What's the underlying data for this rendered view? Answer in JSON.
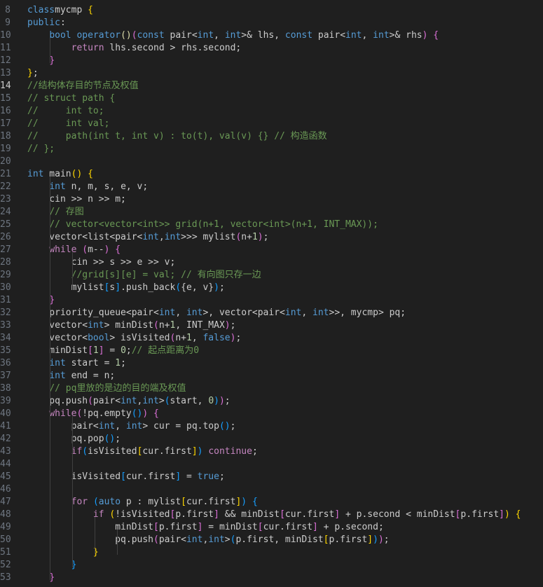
{
  "editor": {
    "background": "#1f1f1f",
    "lines": [
      {
        "n": "8",
        "tokens": [
          [
            "kw",
            "class"
          ],
          [
            "",
            "mycmp "
          ],
          [
            "b1",
            "{"
          ]
        ]
      },
      {
        "n": "9",
        "tokens": [
          [
            "kw",
            "public"
          ],
          [
            "",
            ":"
          ]
        ]
      },
      {
        "n": "10",
        "tokens": [
          [
            "",
            "    "
          ],
          [
            "kw",
            "bool"
          ],
          [
            "",
            " "
          ],
          [
            "kw",
            "operator"
          ],
          [
            "fn",
            "()"
          ],
          [
            "b2",
            "("
          ],
          [
            "kw",
            "const"
          ],
          [
            "",
            " pair<"
          ],
          [
            "kw",
            "int"
          ],
          [
            "",
            ", "
          ],
          [
            "kw",
            "int"
          ],
          [
            "",
            ">& lhs, "
          ],
          [
            "kw",
            "const"
          ],
          [
            "",
            " pair<"
          ],
          [
            "kw",
            "int"
          ],
          [
            "",
            ", "
          ],
          [
            "kw",
            "int"
          ],
          [
            "",
            ">& rhs"
          ],
          [
            "b2",
            ")"
          ],
          [
            "",
            " "
          ],
          [
            "b2",
            "{"
          ]
        ]
      },
      {
        "n": "11",
        "tokens": [
          [
            "",
            "        "
          ],
          [
            "ctl",
            "return"
          ],
          [
            "",
            " lhs.second > rhs.second;"
          ]
        ]
      },
      {
        "n": "12",
        "tokens": [
          [
            "",
            "    "
          ],
          [
            "b2",
            "}"
          ]
        ]
      },
      {
        "n": "13",
        "tokens": [
          [
            "b1",
            "}"
          ],
          [
            "",
            ";"
          ]
        ]
      },
      {
        "n": "14",
        "current": true,
        "tokens": [
          [
            "cm",
            "//结构体存目的节点及权值"
          ]
        ]
      },
      {
        "n": "15",
        "tokens": [
          [
            "cm",
            "// struct path {"
          ]
        ]
      },
      {
        "n": "16",
        "tokens": [
          [
            "cm",
            "//     int to;"
          ]
        ]
      },
      {
        "n": "17",
        "tokens": [
          [
            "cm",
            "//     int val;"
          ]
        ]
      },
      {
        "n": "18",
        "tokens": [
          [
            "cm",
            "//     path(int t, int v) : to(t), val(v) {} // 构造函数"
          ]
        ]
      },
      {
        "n": "19",
        "tokens": [
          [
            "cm",
            "// };"
          ]
        ]
      },
      {
        "n": "20",
        "tokens": []
      },
      {
        "n": "21",
        "tokens": [
          [
            "kw",
            "int"
          ],
          [
            "",
            " main"
          ],
          [
            "b1",
            "()"
          ],
          [
            "",
            " "
          ],
          [
            "b1",
            "{"
          ]
        ]
      },
      {
        "n": "22",
        "tokens": [
          [
            "",
            "    "
          ],
          [
            "kw",
            "int"
          ],
          [
            "",
            " n, m, s, e, v;"
          ]
        ]
      },
      {
        "n": "23",
        "tokens": [
          [
            "",
            "    cin >> n >> m;"
          ]
        ]
      },
      {
        "n": "24",
        "tokens": [
          [
            "",
            "    "
          ],
          [
            "cm",
            "// 存图"
          ]
        ]
      },
      {
        "n": "25",
        "tokens": [
          [
            "",
            "    "
          ],
          [
            "cm",
            "// vector<vector<int>> grid(n+1, vector<int>(n+1, INT_MAX));"
          ]
        ]
      },
      {
        "n": "26",
        "tokens": [
          [
            "",
            "    vector<list<pair<"
          ],
          [
            "kw",
            "int"
          ],
          [
            "",
            ","
          ],
          [
            "kw",
            "int"
          ],
          [
            "",
            ">>> mylist"
          ],
          [
            "b2",
            "("
          ],
          [
            "",
            "n+"
          ],
          [
            "num",
            "1"
          ],
          [
            "b2",
            ")"
          ],
          [
            "",
            ";"
          ]
        ]
      },
      {
        "n": "27",
        "tokens": [
          [
            "",
            "    "
          ],
          [
            "ctl",
            "while"
          ],
          [
            "",
            " "
          ],
          [
            "b2",
            "("
          ],
          [
            "",
            "m--"
          ],
          [
            "b2",
            ")"
          ],
          [
            "",
            " "
          ],
          [
            "b2",
            "{"
          ]
        ]
      },
      {
        "n": "28",
        "tokens": [
          [
            "",
            "        cin >> s >> e >> v;"
          ]
        ]
      },
      {
        "n": "29",
        "tokens": [
          [
            "",
            "        "
          ],
          [
            "cm",
            "//grid[s][e] = val; // 有向图只存一边"
          ]
        ]
      },
      {
        "n": "30",
        "tokens": [
          [
            "",
            "        mylist"
          ],
          [
            "b3",
            "["
          ],
          [
            "",
            "s"
          ],
          [
            "b3",
            "]"
          ],
          [
            "",
            ".push_back"
          ],
          [
            "b3",
            "("
          ],
          [
            "",
            "{e, v}"
          ],
          [
            "b3",
            ")"
          ],
          [
            "",
            ";"
          ]
        ]
      },
      {
        "n": "31",
        "tokens": [
          [
            "",
            "    "
          ],
          [
            "b2",
            "}"
          ]
        ]
      },
      {
        "n": "32",
        "tokens": [
          [
            "",
            "    priority_queue<pair<"
          ],
          [
            "kw",
            "int"
          ],
          [
            "",
            ", "
          ],
          [
            "kw",
            "int"
          ],
          [
            "",
            ">, vector<pair<"
          ],
          [
            "kw",
            "int"
          ],
          [
            "",
            ", "
          ],
          [
            "kw",
            "int"
          ],
          [
            "",
            ">>, mycmp> pq;"
          ]
        ]
      },
      {
        "n": "33",
        "tokens": [
          [
            "",
            "    vector<"
          ],
          [
            "kw",
            "int"
          ],
          [
            "",
            "> minDist"
          ],
          [
            "b2",
            "("
          ],
          [
            "",
            "n+"
          ],
          [
            "num",
            "1"
          ],
          [
            "",
            ", INT_MAX"
          ],
          [
            "b2",
            ")"
          ],
          [
            "",
            ";"
          ]
        ]
      },
      {
        "n": "34",
        "tokens": [
          [
            "",
            "    vector<"
          ],
          [
            "kw",
            "bool"
          ],
          [
            "",
            "> isVisited"
          ],
          [
            "b2",
            "("
          ],
          [
            "",
            "n+"
          ],
          [
            "num",
            "1"
          ],
          [
            "",
            ", "
          ],
          [
            "kw",
            "false"
          ],
          [
            "b2",
            ")"
          ],
          [
            "",
            ";"
          ]
        ]
      },
      {
        "n": "35",
        "tokens": [
          [
            "",
            "    minDist"
          ],
          [
            "b2",
            "["
          ],
          [
            "num",
            "1"
          ],
          [
            "b2",
            "]"
          ],
          [
            "",
            " = "
          ],
          [
            "num",
            "0"
          ],
          [
            "",
            ";"
          ],
          [
            "cm",
            "// 起点距离为0"
          ]
        ]
      },
      {
        "n": "36",
        "tokens": [
          [
            "",
            "    "
          ],
          [
            "kw",
            "int"
          ],
          [
            "",
            " start = "
          ],
          [
            "num",
            "1"
          ],
          [
            "",
            ";"
          ]
        ]
      },
      {
        "n": "37",
        "tokens": [
          [
            "",
            "    "
          ],
          [
            "kw",
            "int"
          ],
          [
            "",
            " end = n;"
          ]
        ]
      },
      {
        "n": "38",
        "tokens": [
          [
            "",
            "    "
          ],
          [
            "cm",
            "// pq里放的是边的目的端及权值"
          ]
        ]
      },
      {
        "n": "39",
        "tokens": [
          [
            "",
            "    pq.push"
          ],
          [
            "b2",
            "("
          ],
          [
            "",
            "pair<"
          ],
          [
            "kw",
            "int"
          ],
          [
            "",
            ","
          ],
          [
            "kw",
            "int"
          ],
          [
            "",
            ">"
          ],
          [
            "b3",
            "("
          ],
          [
            "",
            "start, "
          ],
          [
            "num",
            "0"
          ],
          [
            "b3",
            ")"
          ],
          [
            "b2",
            ")"
          ],
          [
            "",
            ";"
          ]
        ]
      },
      {
        "n": "40",
        "tokens": [
          [
            "",
            "    "
          ],
          [
            "ctl",
            "while"
          ],
          [
            "b2",
            "("
          ],
          [
            "",
            "!pq.empty"
          ],
          [
            "b3",
            "()"
          ],
          [
            "b2",
            ")"
          ],
          [
            "",
            " "
          ],
          [
            "b2",
            "{"
          ]
        ]
      },
      {
        "n": "41",
        "tokens": [
          [
            "",
            "        pair<"
          ],
          [
            "kw",
            "int"
          ],
          [
            "",
            ", "
          ],
          [
            "kw",
            "int"
          ],
          [
            "",
            "> cur = pq.top"
          ],
          [
            "b3",
            "()"
          ],
          [
            "",
            ";"
          ]
        ]
      },
      {
        "n": "42",
        "tokens": [
          [
            "",
            "        pq.pop"
          ],
          [
            "b3",
            "()"
          ],
          [
            "",
            ";"
          ]
        ]
      },
      {
        "n": "43",
        "tokens": [
          [
            "",
            "        "
          ],
          [
            "ctl",
            "if"
          ],
          [
            "b3",
            "("
          ],
          [
            "",
            "isVisited"
          ],
          [
            "b1",
            "["
          ],
          [
            "",
            "cur.first"
          ],
          [
            "b1",
            "]"
          ],
          [
            "b3",
            ")"
          ],
          [
            "",
            " "
          ],
          [
            "ctl",
            "continue"
          ],
          [
            "",
            ";"
          ]
        ]
      },
      {
        "n": "44",
        "tokens": []
      },
      {
        "n": "45",
        "tokens": [
          [
            "",
            "        isVisited"
          ],
          [
            "b3",
            "["
          ],
          [
            "",
            "cur.first"
          ],
          [
            "b3",
            "]"
          ],
          [
            "",
            " = "
          ],
          [
            "kw",
            "true"
          ],
          [
            "",
            ";"
          ]
        ]
      },
      {
        "n": "46",
        "tokens": []
      },
      {
        "n": "47",
        "tokens": [
          [
            "",
            "        "
          ],
          [
            "ctl",
            "for"
          ],
          [
            "",
            " "
          ],
          [
            "b3",
            "("
          ],
          [
            "kw",
            "auto"
          ],
          [
            "",
            " p : mylist"
          ],
          [
            "b1",
            "["
          ],
          [
            "",
            "cur.first"
          ],
          [
            "b1",
            "]"
          ],
          [
            "b3",
            ")"
          ],
          [
            "",
            " "
          ],
          [
            "b3",
            "{"
          ]
        ]
      },
      {
        "n": "48",
        "tokens": [
          [
            "",
            "            "
          ],
          [
            "ctl",
            "if"
          ],
          [
            "",
            " "
          ],
          [
            "b1",
            "("
          ],
          [
            "",
            "!isVisited"
          ],
          [
            "b2",
            "["
          ],
          [
            "",
            "p.first"
          ],
          [
            "b2",
            "]"
          ],
          [
            "",
            " && minDist"
          ],
          [
            "b2",
            "["
          ],
          [
            "",
            "cur.first"
          ],
          [
            "b2",
            "]"
          ],
          [
            "",
            " + p.second < minDist"
          ],
          [
            "b2",
            "["
          ],
          [
            "",
            "p.first"
          ],
          [
            "b2",
            "]"
          ],
          [
            "b1",
            ")"
          ],
          [
            "",
            " "
          ],
          [
            "b1",
            "{"
          ]
        ]
      },
      {
        "n": "49",
        "tokens": [
          [
            "",
            "                minDist"
          ],
          [
            "b2",
            "["
          ],
          [
            "",
            "p.first"
          ],
          [
            "b2",
            "]"
          ],
          [
            "",
            " = minDist"
          ],
          [
            "b2",
            "["
          ],
          [
            "",
            "cur.first"
          ],
          [
            "b2",
            "]"
          ],
          [
            "",
            " + p.second;"
          ]
        ]
      },
      {
        "n": "50",
        "tokens": [
          [
            "",
            "                pq.push"
          ],
          [
            "b2",
            "("
          ],
          [
            "",
            "pair<"
          ],
          [
            "kw",
            "int"
          ],
          [
            "",
            ","
          ],
          [
            "kw",
            "int"
          ],
          [
            "",
            ">"
          ],
          [
            "b3",
            "("
          ],
          [
            "",
            "p.first, minDist"
          ],
          [
            "b1",
            "["
          ],
          [
            "",
            "p.first"
          ],
          [
            "b1",
            "]"
          ],
          [
            "b3",
            ")"
          ],
          [
            "b2",
            ")"
          ],
          [
            "",
            ";"
          ]
        ]
      },
      {
        "n": "51",
        "tokens": [
          [
            "",
            "            "
          ],
          [
            "b1",
            "}"
          ]
        ]
      },
      {
        "n": "52",
        "tokens": [
          [
            "",
            "        "
          ],
          [
            "b3",
            "}"
          ]
        ]
      },
      {
        "n": "53",
        "tokens": [
          [
            "",
            "    "
          ],
          [
            "b2",
            "}"
          ]
        ]
      }
    ]
  }
}
